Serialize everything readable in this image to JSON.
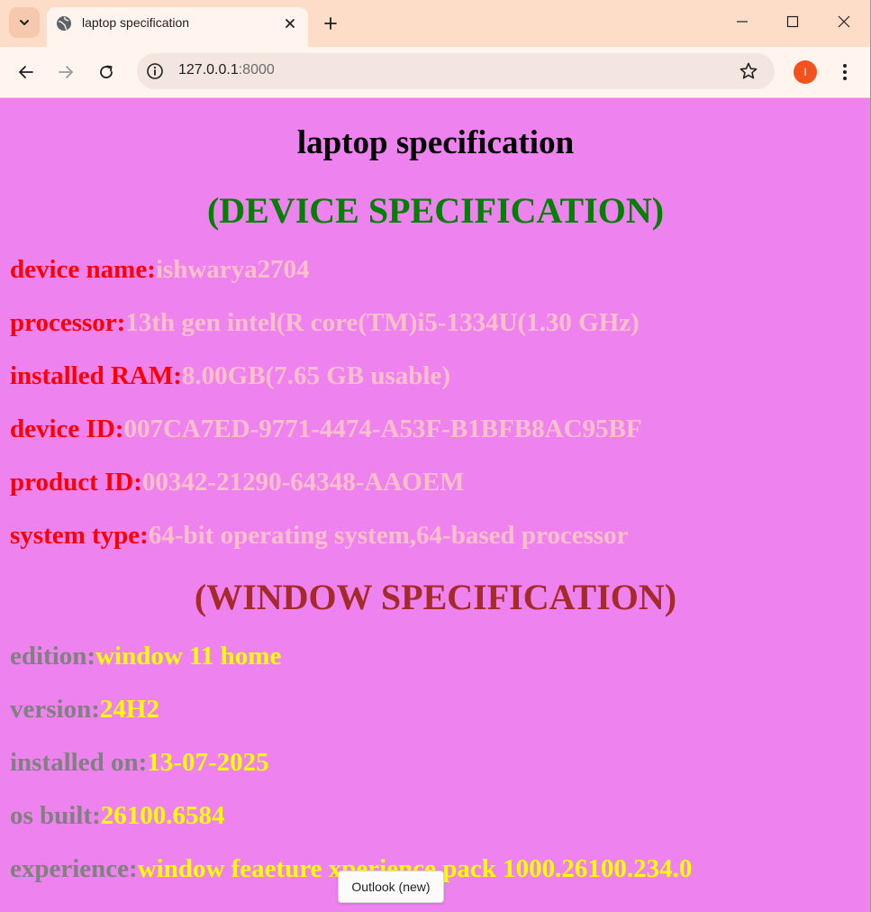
{
  "browser": {
    "tab_title": "laptop specification",
    "url_host": "127.0.0.1",
    "url_port": ":8000",
    "profile_initial": "I",
    "accent": "#f4511e"
  },
  "page": {
    "title": "laptop specification",
    "device_heading": "(DEVICE SPECIFICATION)",
    "device_specs": [
      {
        "label": "device name:",
        "value": "ishwarya2704"
      },
      {
        "label": "processor:",
        "value": "13th gen intel(R core(TM)i5-1334U(1.30 GHz)"
      },
      {
        "label": "installed RAM:",
        "value": "8.00GB(7.65 GB usable)"
      },
      {
        "label": "device ID:",
        "value": "007CA7ED-9771-4474-A53F-B1BFB8AC95BF"
      },
      {
        "label": "product ID:",
        "value": "00342-21290-64348-AAOEM"
      },
      {
        "label": "system type:",
        "value": "64-bit operating system,64-based processor"
      }
    ],
    "window_heading": "(WINDOW SPECIFICATION)",
    "window_specs": [
      {
        "label": "edition:",
        "value": "window 11 home"
      },
      {
        "label": "version:",
        "value": "24H2"
      },
      {
        "label": "installed on:",
        "value": "13-07-2025"
      },
      {
        "label": "os built:",
        "value": "26100.6584"
      },
      {
        "label": "experience:",
        "value": "window feaeture xperience pack 1000.26100.234.0"
      }
    ],
    "colors": {
      "background": "#ee82ee",
      "device_heading": "#008000",
      "window_heading": "#a52a2a",
      "device_label": "#ff0000",
      "device_value": "#ffc0cb",
      "window_label": "#808080",
      "window_value": "#ffff00"
    }
  },
  "tooltip": {
    "text": "Outlook (new)"
  }
}
